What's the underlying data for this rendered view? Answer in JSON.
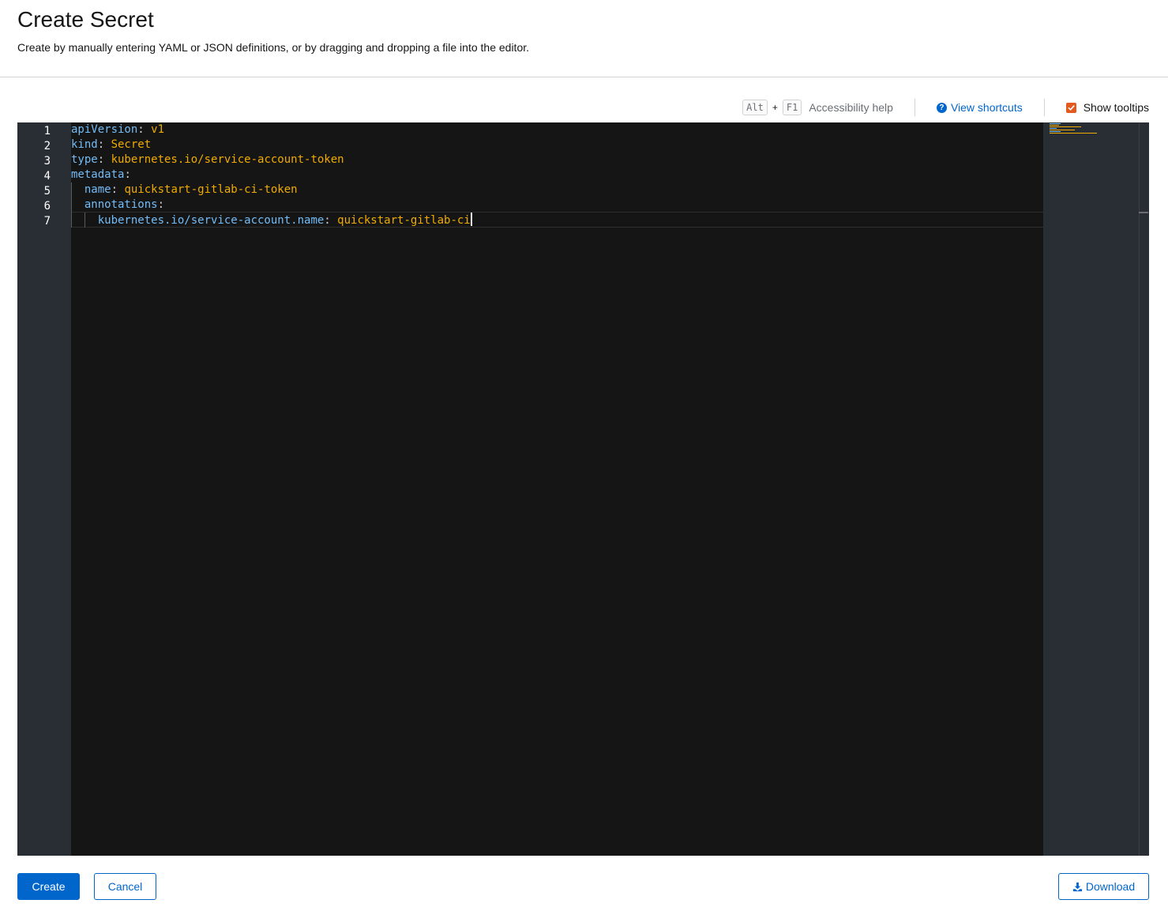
{
  "header": {
    "title": "Create Secret",
    "description": "Create by manually entering YAML or JSON definitions, or by dragging and dropping a file into the editor."
  },
  "toolbar": {
    "key_alt": "Alt",
    "key_plus": "+",
    "key_f1": "F1",
    "accessibility_help": "Accessibility help",
    "view_shortcuts": "View shortcuts",
    "show_tooltips": "Show tooltips",
    "show_tooltips_checked": true
  },
  "editor": {
    "line_numbers": [
      "1",
      "2",
      "3",
      "4",
      "5",
      "6",
      "7"
    ],
    "lines": [
      {
        "indent": "",
        "key": "apiVersion",
        "sep": ": ",
        "value": "v1"
      },
      {
        "indent": "",
        "key": "kind",
        "sep": ": ",
        "value": "Secret"
      },
      {
        "indent": "",
        "key": "type",
        "sep": ": ",
        "value": "kubernetes.io/service-account-token"
      },
      {
        "indent": "",
        "key": "metadata",
        "sep": ":",
        "value": ""
      },
      {
        "indent": "  ",
        "key": "name",
        "sep": ": ",
        "value": "quickstart-gitlab-ci-token"
      },
      {
        "indent": "  ",
        "key": "annotations",
        "sep": ":",
        "value": ""
      },
      {
        "indent": "    ",
        "key": "kubernetes.io/service-account.name",
        "sep": ": ",
        "value": "quickstart-gitlab-ci"
      }
    ],
    "colors": {
      "background": "#151515",
      "gutter": "#292e34",
      "key": "#73bcf7",
      "value": "#f0ab00"
    }
  },
  "actions": {
    "create": "Create",
    "cancel": "Cancel",
    "download": "Download"
  },
  "colors": {
    "primary": "#0066cc",
    "checkbox": "#e3591f"
  }
}
